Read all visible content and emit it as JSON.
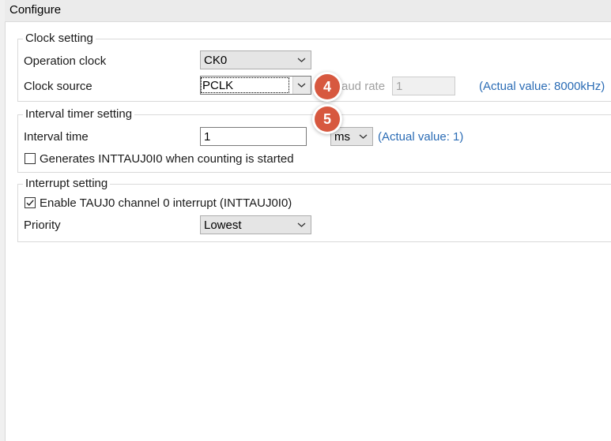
{
  "header": {
    "title": "Configure"
  },
  "clock_setting": {
    "legend": "Clock setting",
    "operation_clock": {
      "label": "Operation clock",
      "value": "CK0"
    },
    "clock_source": {
      "label": "Clock source",
      "value": "PCLK"
    },
    "baud_rate": {
      "label": "Baud rate",
      "visible_label": "aud rate",
      "value": "1"
    },
    "actual_value": "(Actual value: 8000kHz)"
  },
  "interval_timer_setting": {
    "legend": "Interval timer setting",
    "interval_time": {
      "label": "Interval time",
      "value": "1",
      "unit": "ms"
    },
    "actual_value": "(Actual value: 1)",
    "generates_checkbox": {
      "label": "Generates INTTAUJ0I0 when counting is started",
      "checked": false
    }
  },
  "interrupt_setting": {
    "legend": "Interrupt setting",
    "enable_checkbox": {
      "label": "Enable TAUJ0 channel 0 interrupt (INTTAUJ0I0)",
      "checked": true
    },
    "priority": {
      "label": "Priority",
      "value": "Lowest"
    }
  },
  "callouts": [
    {
      "number": "4"
    },
    {
      "number": "5"
    }
  ],
  "colors": {
    "accent_blue": "#2b6cb5",
    "callout_orange": "#d7583f"
  }
}
